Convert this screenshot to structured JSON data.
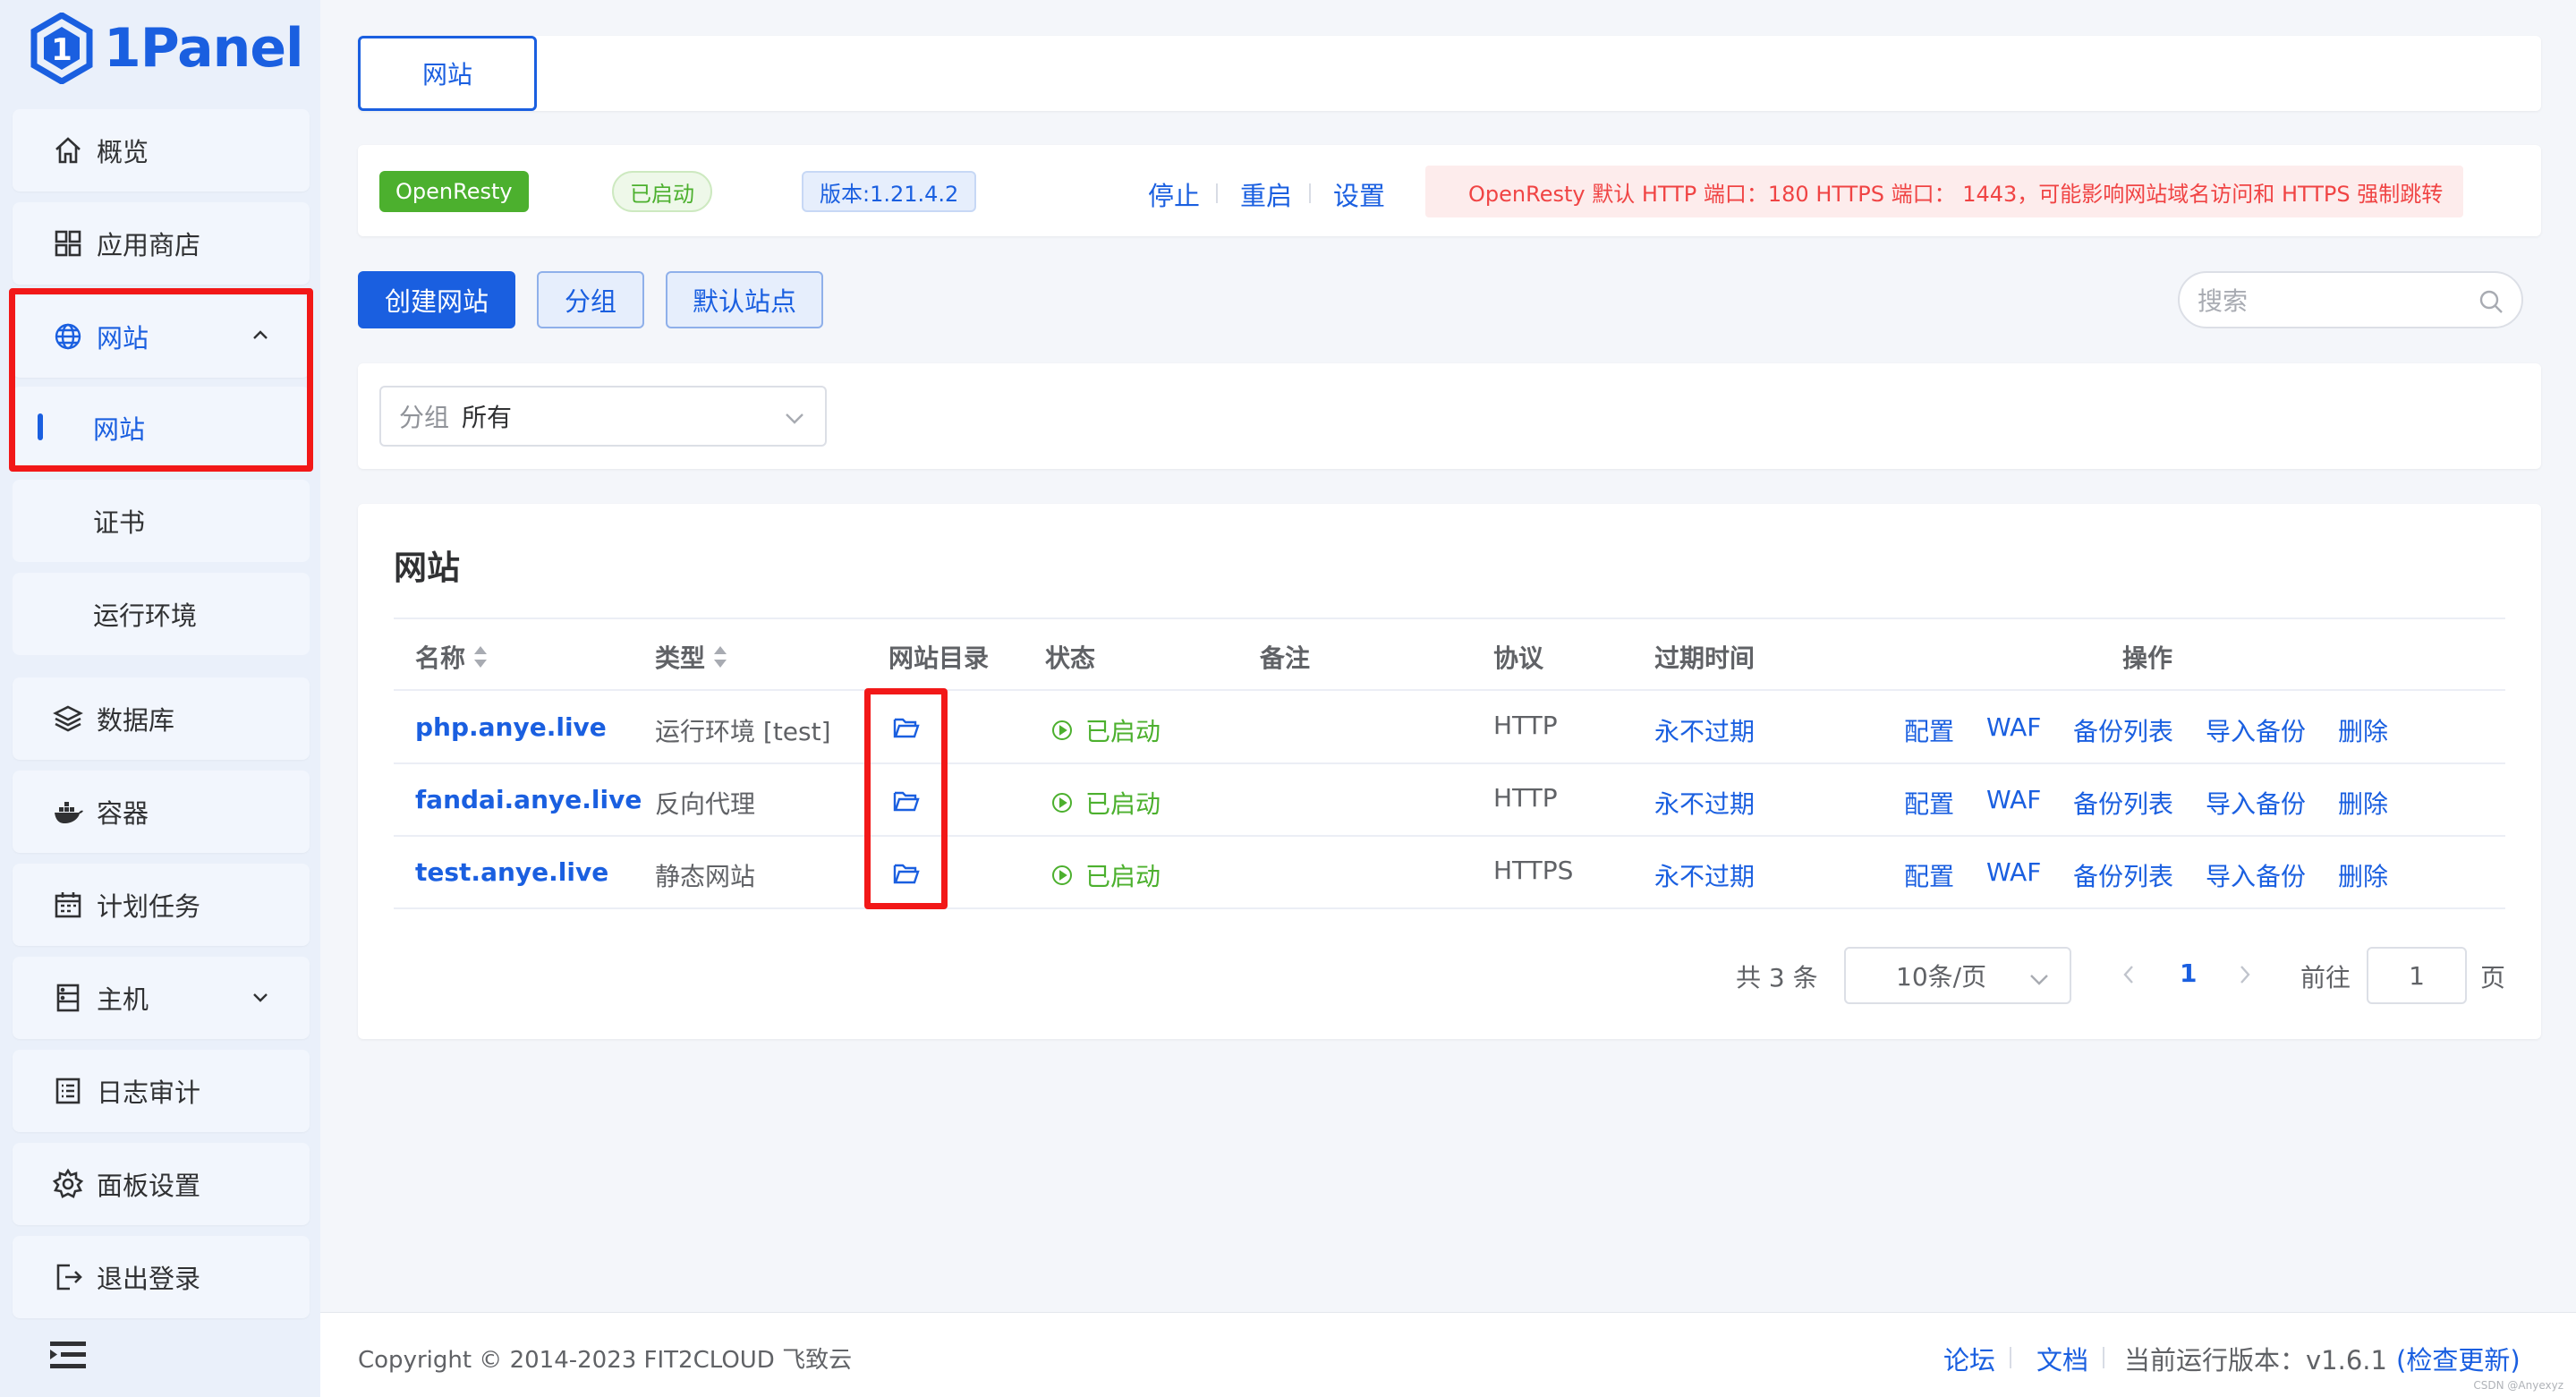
{
  "brand": {
    "name": "1Panel"
  },
  "sidebar": {
    "items": [
      {
        "label": "概览",
        "icon": "home-icon"
      },
      {
        "label": "应用商店",
        "icon": "apps-grid-icon"
      },
      {
        "label": "网站",
        "icon": "globe-icon"
      },
      {
        "label": "数据库",
        "icon": "layers-icon"
      },
      {
        "label": "容器",
        "icon": "docker-icon"
      },
      {
        "label": "计划任务",
        "icon": "calendar-icon"
      },
      {
        "label": "主机",
        "icon": "server-icon"
      },
      {
        "label": "日志审计",
        "icon": "log-list-icon"
      },
      {
        "label": "面板设置",
        "icon": "gear-icon"
      },
      {
        "label": "退出登录",
        "icon": "logout-icon"
      }
    ],
    "website_sub": [
      "网站",
      "证书",
      "运行环境"
    ]
  },
  "header": {
    "tab_label": "网站"
  },
  "status_bar": {
    "app": "OpenResty",
    "state": "已启动",
    "version": "版本:1.21.4.2",
    "actions": [
      "停止",
      "重启",
      "设置"
    ],
    "alert": "OpenResty 默认 HTTP 端口：180 HTTPS 端口： 1443，可能影响网站域名访问和 HTTPS 强制跳转"
  },
  "toolbar": {
    "create": "创建网站",
    "group": "分组",
    "default_site": "默认站点",
    "search_placeholder": "搜索"
  },
  "filter": {
    "group_label": "分组",
    "group_value": "所有"
  },
  "table": {
    "title": "网站",
    "headers": [
      "名称",
      "类型",
      "网站目录",
      "状态",
      "备注",
      "协议",
      "过期时间",
      "操作"
    ],
    "rows": [
      {
        "name": "php.anye.live",
        "type": "运行环境 [test]",
        "status": "已启动",
        "protocol": "HTTP",
        "expire": "永不过期"
      },
      {
        "name": "fandai.anye.live",
        "type": "反向代理",
        "status": "已启动",
        "protocol": "HTTP",
        "expire": "永不过期"
      },
      {
        "name": "test.anye.live",
        "type": "静态网站",
        "status": "已启动",
        "protocol": "HTTPS",
        "expire": "永不过期"
      }
    ],
    "row_actions": [
      "配置",
      "WAF",
      "备份列表",
      "导入备份",
      "删除"
    ]
  },
  "pagination": {
    "total": "共 3 条",
    "page_size": "10条/页",
    "current": "1",
    "goto_label": "前往",
    "goto_value": "1",
    "page_suffix": "页"
  },
  "footer": {
    "copyright": "Copyright © 2014-2023 FIT2CLOUD 飞致云",
    "forum": "论坛",
    "docs": "文档",
    "version_text": "当前运行版本：v1.6.1",
    "check_update": "(检查更新)",
    "watermark": "CSDN @Anyexyz"
  },
  "colors": {
    "primary": "#1a5fe0",
    "success": "#4cb02e",
    "danger": "#f04444",
    "highlight": "#f21818"
  }
}
